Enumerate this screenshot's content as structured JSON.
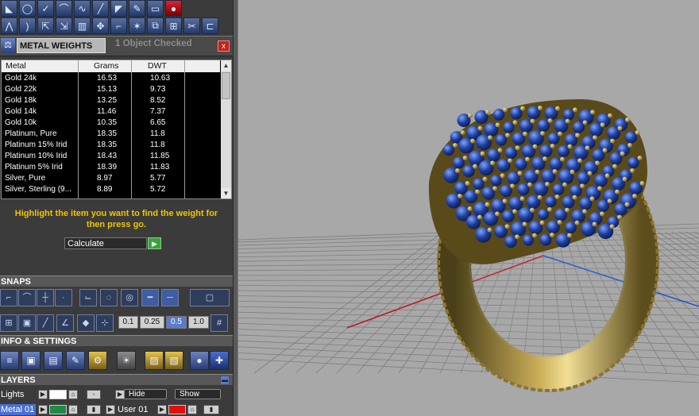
{
  "metal_weights": {
    "tab_title": "METAL WEIGHTS",
    "status": "1 Object Checked",
    "close_glyph": "x",
    "columns": [
      "Metal",
      "Grams",
      "DWT"
    ],
    "rows": [
      {
        "metal": "Gold 24k",
        "grams": "16.53",
        "dwt": "10.63"
      },
      {
        "metal": "Gold 22k",
        "grams": "15.13",
        "dwt": "9.73"
      },
      {
        "metal": "Gold 18k",
        "grams": "13.25",
        "dwt": "8.52"
      },
      {
        "metal": "Gold 14k",
        "grams": "11.46",
        "dwt": "7.37"
      },
      {
        "metal": "Gold 10k",
        "grams": "10.35",
        "dwt": "6.65"
      },
      {
        "metal": "Platinum, Pure",
        "grams": "18.35",
        "dwt": "11.8"
      },
      {
        "metal": "Platinum 15% Irid",
        "grams": "18.35",
        "dwt": "11.8"
      },
      {
        "metal": "Platinum 10% Irid",
        "grams": "18.43",
        "dwt": "11.85"
      },
      {
        "metal": "Platinum 5% Irid",
        "grams": "18.39",
        "dwt": "11.83"
      },
      {
        "metal": "Silver, Pure",
        "grams": "8.97",
        "dwt": "5.77"
      },
      {
        "metal": "Silver, Sterling (9...",
        "grams": "8.89",
        "dwt": "5.72"
      }
    ],
    "instruction_line1": "Highlight the item you want to find the weight for",
    "instruction_line2": "then press go.",
    "calculate_label": "Calculate"
  },
  "snaps": {
    "title": "SNAPS",
    "values": [
      "0.1",
      "0.25",
      "0.5",
      "1.0"
    ],
    "selected_value": "0.5"
  },
  "info_settings": {
    "title": "INFO & SETTINGS"
  },
  "layers": {
    "title": "LAYERS",
    "rows": [
      {
        "name": "Lights",
        "hide_label": "Hide",
        "show_label": "Show"
      },
      {
        "name": "Metal 01",
        "user_label": "User 01"
      }
    ]
  },
  "colors": {
    "accent_yellow": "#f2c300",
    "panel_bg": "#3b3b3b",
    "viewport_bg": "#a8a8a8",
    "axis_x": "#c0141a",
    "axis_y": "#1e50d8",
    "gem_blue": "#1f3f9e",
    "metal_gold": "#b89a46"
  },
  "toolbar_icons": [
    "lathe-icon",
    "circle-icon",
    "check-icon",
    "curve-icon",
    "spline-icon",
    "knife-icon",
    "cut-icon",
    "paint-icon",
    "mirror-icon",
    "move-icon",
    "polyline-icon",
    "smooth-icon",
    "scale-icon",
    "align-icon",
    "copy-icon",
    "scissors-icon",
    "gem-icon",
    "render-icon"
  ]
}
